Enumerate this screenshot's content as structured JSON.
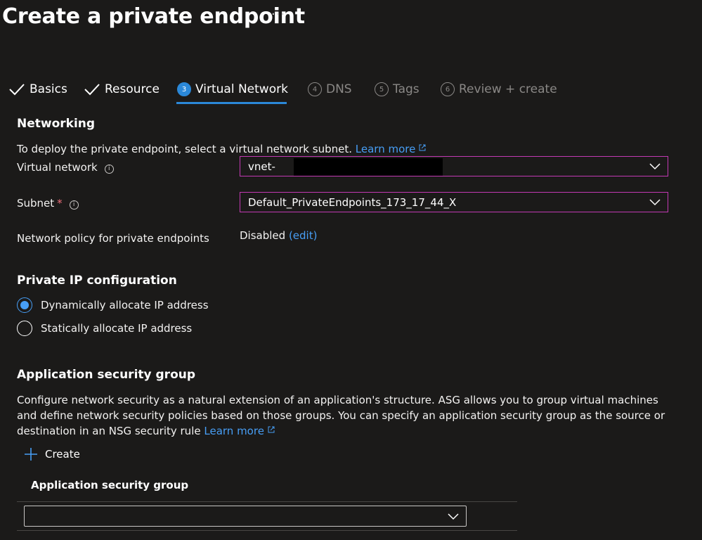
{
  "page": {
    "title": "Create a private endpoint",
    "more_label": "···"
  },
  "tabs": [
    {
      "label": "Basics",
      "state": "done"
    },
    {
      "label": "Resource",
      "state": "done"
    },
    {
      "number": "3",
      "label": "Virtual Network",
      "state": "active"
    },
    {
      "number": "4",
      "label": "DNS",
      "state": "disabled"
    },
    {
      "number": "5",
      "label": "Tags",
      "state": "disabled"
    },
    {
      "number": "6",
      "label": "Review + create",
      "state": "disabled"
    }
  ],
  "networking": {
    "heading": "Networking",
    "description": "To deploy the private endpoint, select a virtual network subnet.",
    "learn_more": "Learn more",
    "vnet_label": "Virtual network",
    "vnet_value": "vnet-",
    "subnet_label": "Subnet",
    "subnet_required": "*",
    "subnet_value": "Default_PrivateEndpoints_173_17_44_X",
    "policy_label": "Network policy for private endpoints",
    "policy_value": "Disabled",
    "policy_edit": "(edit)"
  },
  "ip_config": {
    "heading": "Private IP configuration",
    "options": [
      {
        "label": "Dynamically allocate IP address",
        "checked": true
      },
      {
        "label": "Statically allocate IP address",
        "checked": false
      }
    ]
  },
  "asg": {
    "heading": "Application security group",
    "description": "Configure network security as a natural extension of an application's structure. ASG allows you to group virtual machines and define network security policies based on those groups. You can specify an application security group as the source or destination in an NSG security rule",
    "learn_more": "Learn more",
    "create_label": "Create",
    "column_header": "Application security group",
    "dropdown_value": ""
  },
  "colors": {
    "background": "#1b1a19",
    "accent": "#2b88d8",
    "link": "#479ef5",
    "focus_border": "#c239b3",
    "required": "#f1707b"
  }
}
